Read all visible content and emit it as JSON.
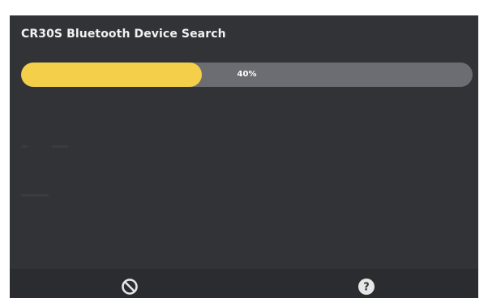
{
  "dialog": {
    "title": "CR30S Bluetooth Device Search"
  },
  "progress": {
    "value": 0.4,
    "label": "40%"
  },
  "footer": {
    "cancel_icon": "cancel-icon",
    "help_icon": "help-icon"
  },
  "colors": {
    "background": "#323337",
    "track": "#6c6d72",
    "fill": "#f4d04a",
    "text": "#f2f2f2"
  }
}
